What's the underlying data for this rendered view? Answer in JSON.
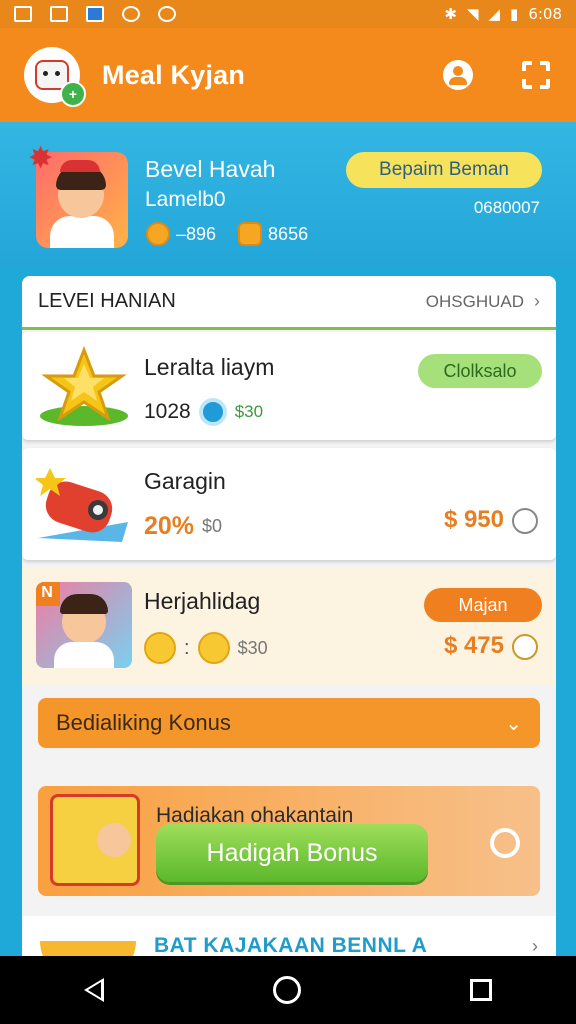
{
  "status_bar": {
    "time": "6:08"
  },
  "app_bar": {
    "title": "Meal Kyjan"
  },
  "header": {
    "name": "Bevel Havah",
    "subtitle": "Lamelb0",
    "coin1_value": "–896",
    "coin2_value": "8656",
    "pill_label": "Bepaim Beman",
    "code": "0680007"
  },
  "card": {
    "title": "LEVEI HANIAN",
    "link_label": "OHSGHUAD",
    "items": [
      {
        "title": "Leralta liaym",
        "value1": "1028",
        "value2": "$30",
        "button": "Clolksalo"
      },
      {
        "title": "Garagin",
        "percent": "20%",
        "value2": "$0",
        "price": "$ 950"
      },
      {
        "title": "Herjahlidag",
        "value2": "$30",
        "price": "$ 475",
        "button": "Majan"
      }
    ],
    "expand_bar": {
      "label": "Bedialiking Konus"
    },
    "bonus": {
      "title": "Hadiakan ohakantain",
      "button": "Hadigah Bonus"
    },
    "bottom": {
      "label": "BAT KAJAKAAN BENNL A"
    }
  },
  "colors": {
    "appbar": "#f48a1c",
    "background": "#1ea9d8",
    "accent_green": "#5cb82b",
    "price_orange": "#e67e22"
  }
}
